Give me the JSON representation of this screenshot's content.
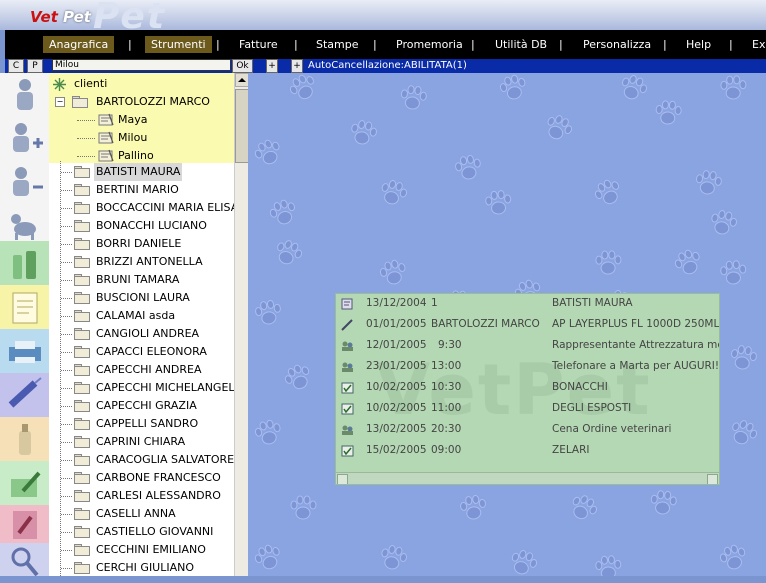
{
  "app": {
    "logo_vet": "Vet",
    "logo_pet": "Pet",
    "logo_bg": "Pet"
  },
  "menu": {
    "items": [
      "Anagrafica",
      "Strumenti",
      "Fatture",
      "Stampe",
      "Promemoria",
      "Utilità DB",
      "Personalizza",
      "Help",
      "Exit"
    ],
    "separator": "|"
  },
  "toolbar": {
    "c_label": "C",
    "p_label": "P",
    "search_value": "Milou",
    "ok_label": "Ok",
    "plus1_label": "+",
    "plus2_label": "+",
    "auto_status": "AutoCancellazione:ABILITATA(1)"
  },
  "tree": {
    "root_label": "clienti",
    "expanded_client": "BARTOLOZZI MARCO",
    "expand_toggle": "−",
    "pets": [
      "Maya",
      "Milou",
      "Pallino"
    ],
    "clients": [
      "BATISTI MAURA",
      "BERTINI MARIO",
      "BOCCACCINI MARIA ELISA",
      "BONACCHI LUCIANO",
      "BORRI DANIELE",
      "BRIZZI ANTONELLA",
      "BRUNI TAMARA",
      "BUSCIONI LAURA",
      "CALAMAI asda",
      "CANGIOLI ANDREA",
      "CAPACCI ELEONORA",
      "CAPECCHI ANDREA",
      "CAPECCHI MICHELANGELO",
      "CAPECCHI GRAZIA",
      "CAPPELLI SANDRO",
      "CAPRINI CHIARA",
      "CARACOGLIA SALVATORE",
      "CARBONE FRANCESCO",
      "CARLESI ALESSANDRO",
      "CASELLI ANNA",
      "CASTIELLO GIOVANNI",
      "CECCHINI EMILIANO",
      "CERCHI GIULIANO"
    ],
    "selected_client": "BATISTI MAURA"
  },
  "agenda": {
    "watermark": "VetPet",
    "rows": [
      {
        "icon": "document-icon",
        "date": "13/12/2004",
        "time": "1",
        "desc": "BATISTI MAURA"
      },
      {
        "icon": "syringe-icon",
        "date": "01/01/2005",
        "time": "BARTOLOZZI MARCO",
        "desc": "AP LAYERPLUS FL 1000D 250ML"
      },
      {
        "icon": "people-icon",
        "date": "12/01/2005",
        "time": "9:30",
        "desc": "Rappresentante Attrezzatura medica"
      },
      {
        "icon": "people-icon",
        "date": "23/01/2005",
        "time": "13:00",
        "desc": "Telefonare a Marta per AUGURI!!!"
      },
      {
        "icon": "check-icon",
        "date": "10/02/2005",
        "time": "10:30",
        "desc": "BONACCHI"
      },
      {
        "icon": "check-icon",
        "date": "10/02/2005",
        "time": "11:00",
        "desc": "DEGLI ESPOSTI"
      },
      {
        "icon": "people-icon",
        "date": "13/02/2005",
        "time": "20:30",
        "desc": "Cena Ordine veterinari"
      },
      {
        "icon": "check-icon",
        "date": "15/02/2005",
        "time": "09:00",
        "desc": "ZELARI"
      }
    ]
  },
  "sidebar_icons": [
    "person-icon",
    "add-person-icon",
    "remove-person-icon",
    "dog-icon",
    "bottles-icon",
    "clipboard-icon",
    "printer-icon",
    "syringe-icon",
    "bottle-icon",
    "edit-icon",
    "brush-icon",
    "search-icon"
  ],
  "colors": {
    "menu_active": "#6b5a1c",
    "toolbar_bg": "#0a2ba8",
    "tree_highlight": "#fafab0",
    "agenda_bg": "#b4d8b4",
    "desktop_bg": "#8aa4e2"
  }
}
